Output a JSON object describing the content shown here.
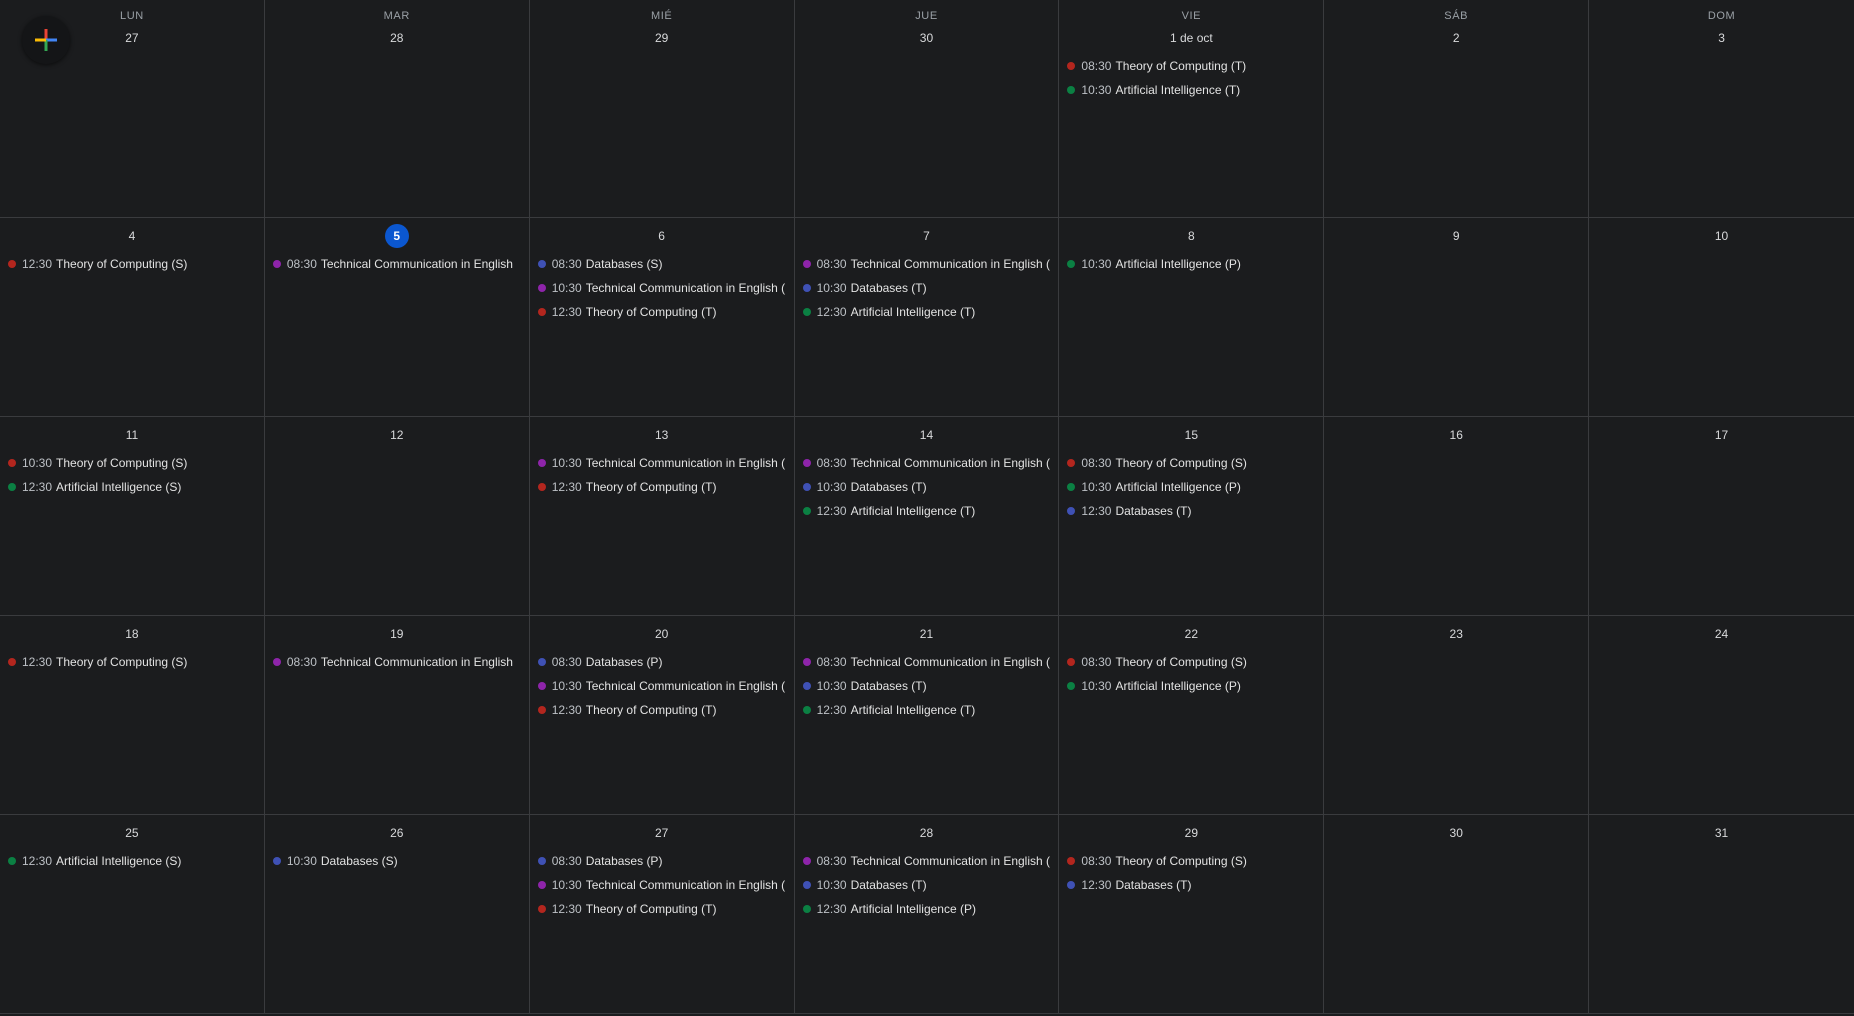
{
  "colors": {
    "background": "#1b1c1e",
    "gridline": "#3a3b3e",
    "today_badge": "#0b57d0",
    "calendar_theory": "#b3261e",
    "calendar_ai": "#0b8043",
    "calendar_databases": "#3f51b5",
    "calendar_techcomm": "#8e24aa"
  },
  "fab": {
    "icon": "plus-icon"
  },
  "weekdays": [
    "LUN",
    "MAR",
    "MIÉ",
    "JUE",
    "VIE",
    "SÁB",
    "DOM"
  ],
  "weeks": [
    {
      "days": [
        {
          "date": "27",
          "events": []
        },
        {
          "date": "28",
          "events": []
        },
        {
          "date": "29",
          "events": []
        },
        {
          "date": "30",
          "events": []
        },
        {
          "date": "1 de oct",
          "events": [
            {
              "time": "08:30",
              "title": "Theory of Computing (T)",
              "calendar": "theory"
            },
            {
              "time": "10:30",
              "title": "Artificial Intelligence (T)",
              "calendar": "ai"
            }
          ]
        },
        {
          "date": "2",
          "events": []
        },
        {
          "date": "3",
          "events": []
        }
      ]
    },
    {
      "days": [
        {
          "date": "4",
          "events": [
            {
              "time": "12:30",
              "title": "Theory of Computing (S)",
              "calendar": "theory"
            }
          ]
        },
        {
          "date": "5",
          "today": true,
          "events": [
            {
              "time": "08:30",
              "title": "Technical Communication in English",
              "calendar": "techcomm"
            }
          ]
        },
        {
          "date": "6",
          "events": [
            {
              "time": "08:30",
              "title": "Databases (S)",
              "calendar": "databases"
            },
            {
              "time": "10:30",
              "title": "Technical Communication in English (",
              "calendar": "techcomm"
            },
            {
              "time": "12:30",
              "title": "Theory of Computing (T)",
              "calendar": "theory"
            }
          ]
        },
        {
          "date": "7",
          "events": [
            {
              "time": "08:30",
              "title": "Technical Communication in English (",
              "calendar": "techcomm"
            },
            {
              "time": "10:30",
              "title": "Databases (T)",
              "calendar": "databases"
            },
            {
              "time": "12:30",
              "title": "Artificial Intelligence (T)",
              "calendar": "ai"
            }
          ]
        },
        {
          "date": "8",
          "events": [
            {
              "time": "10:30",
              "title": "Artificial Intelligence (P)",
              "calendar": "ai"
            }
          ]
        },
        {
          "date": "9",
          "events": []
        },
        {
          "date": "10",
          "events": []
        }
      ]
    },
    {
      "days": [
        {
          "date": "11",
          "events": [
            {
              "time": "10:30",
              "title": "Theory of Computing (S)",
              "calendar": "theory"
            },
            {
              "time": "12:30",
              "title": "Artificial Intelligence (S)",
              "calendar": "ai"
            }
          ]
        },
        {
          "date": "12",
          "events": []
        },
        {
          "date": "13",
          "events": [
            {
              "time": "10:30",
              "title": "Technical Communication in English (",
              "calendar": "techcomm"
            },
            {
              "time": "12:30",
              "title": "Theory of Computing (T)",
              "calendar": "theory"
            }
          ]
        },
        {
          "date": "14",
          "events": [
            {
              "time": "08:30",
              "title": "Technical Communication in English (",
              "calendar": "techcomm"
            },
            {
              "time": "10:30",
              "title": "Databases (T)",
              "calendar": "databases"
            },
            {
              "time": "12:30",
              "title": "Artificial Intelligence (T)",
              "calendar": "ai"
            }
          ]
        },
        {
          "date": "15",
          "events": [
            {
              "time": "08:30",
              "title": "Theory of Computing (S)",
              "calendar": "theory"
            },
            {
              "time": "10:30",
              "title": "Artificial Intelligence (P)",
              "calendar": "ai"
            },
            {
              "time": "12:30",
              "title": "Databases (T)",
              "calendar": "databases"
            }
          ]
        },
        {
          "date": "16",
          "events": []
        },
        {
          "date": "17",
          "events": []
        }
      ]
    },
    {
      "days": [
        {
          "date": "18",
          "events": [
            {
              "time": "12:30",
              "title": "Theory of Computing (S)",
              "calendar": "theory"
            }
          ]
        },
        {
          "date": "19",
          "events": [
            {
              "time": "08:30",
              "title": "Technical Communication in English",
              "calendar": "techcomm"
            }
          ]
        },
        {
          "date": "20",
          "events": [
            {
              "time": "08:30",
              "title": "Databases (P)",
              "calendar": "databases"
            },
            {
              "time": "10:30",
              "title": "Technical Communication in English (",
              "calendar": "techcomm"
            },
            {
              "time": "12:30",
              "title": "Theory of Computing (T)",
              "calendar": "theory"
            }
          ]
        },
        {
          "date": "21",
          "events": [
            {
              "time": "08:30",
              "title": "Technical Communication in English (",
              "calendar": "techcomm"
            },
            {
              "time": "10:30",
              "title": "Databases (T)",
              "calendar": "databases"
            },
            {
              "time": "12:30",
              "title": "Artificial Intelligence (T)",
              "calendar": "ai"
            }
          ]
        },
        {
          "date": "22",
          "events": [
            {
              "time": "08:30",
              "title": "Theory of Computing (S)",
              "calendar": "theory"
            },
            {
              "time": "10:30",
              "title": "Artificial Intelligence (P)",
              "calendar": "ai"
            }
          ]
        },
        {
          "date": "23",
          "events": []
        },
        {
          "date": "24",
          "events": []
        }
      ]
    },
    {
      "days": [
        {
          "date": "25",
          "events": [
            {
              "time": "12:30",
              "title": "Artificial Intelligence (S)",
              "calendar": "ai"
            }
          ]
        },
        {
          "date": "26",
          "events": [
            {
              "time": "10:30",
              "title": "Databases (S)",
              "calendar": "databases"
            }
          ]
        },
        {
          "date": "27",
          "events": [
            {
              "time": "08:30",
              "title": "Databases (P)",
              "calendar": "databases"
            },
            {
              "time": "10:30",
              "title": "Technical Communication in English (",
              "calendar": "techcomm"
            },
            {
              "time": "12:30",
              "title": "Theory of Computing (T)",
              "calendar": "theory"
            }
          ]
        },
        {
          "date": "28",
          "events": [
            {
              "time": "08:30",
              "title": "Technical Communication in English (",
              "calendar": "techcomm"
            },
            {
              "time": "10:30",
              "title": "Databases (T)",
              "calendar": "databases"
            },
            {
              "time": "12:30",
              "title": "Artificial Intelligence (P)",
              "calendar": "ai"
            }
          ]
        },
        {
          "date": "29",
          "events": [
            {
              "time": "08:30",
              "title": "Theory of Computing (S)",
              "calendar": "theory"
            },
            {
              "time": "12:30",
              "title": "Databases (T)",
              "calendar": "databases"
            }
          ]
        },
        {
          "date": "30",
          "events": []
        },
        {
          "date": "31",
          "events": []
        }
      ]
    }
  ]
}
